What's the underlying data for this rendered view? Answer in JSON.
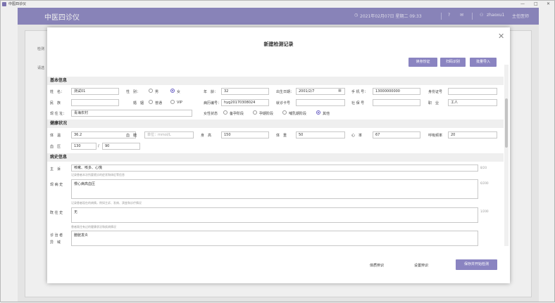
{
  "window": {
    "title": "中医四诊仪",
    "min": "—",
    "max": "□",
    "close": "✕"
  },
  "topbar": {
    "app_title": "中医四诊仪",
    "datetime": "2021年02月07日 星期二 09:33",
    "user": "zhaoxu1",
    "role": "主任医师"
  },
  "background": {
    "label_1": "检测",
    "label_2": "请选"
  },
  "modal": {
    "title": "新建检测记录",
    "buttons": {
      "read_id": "读身份证",
      "scan_code": "扫码识别",
      "quick_import": "批量导入"
    },
    "basic": {
      "heading": "基本信息",
      "name_label": "姓　名：",
      "name_value": "测试01",
      "gender_label": "性　别：",
      "gender_male": "男",
      "gender_female": "女",
      "age_label": "年　龄：",
      "age_value": "32",
      "birth_label": "出生日期：",
      "birth_value": "2001/2/7",
      "phone_label": "手 机 号：",
      "phone_value": "13000000000",
      "idcard_label": "身份证号",
      "ethnic_label": "民　族",
      "marital_label": "婚　姻",
      "marital_opt1": "普通",
      "marital_opt2": "VIP",
      "code_label": "病历编号：",
      "code_value": "hyg20170308024",
      "medical_label": "就诊卡号",
      "social_label": "社 保 号",
      "job_label": "职　业",
      "job_value": "工人",
      "addr_label": "现 住 址：",
      "addr_value": "青海农村",
      "female_status_label": "女性状态",
      "female_opt1": "备孕阶段",
      "female_opt2": "孕期阶段",
      "female_opt3": "哺乳期阶段",
      "female_opt4": "其他"
    },
    "vitals": {
      "heading": "健康状况",
      "temp_label": "体　温",
      "temp_value": "36.2",
      "bp_label": "血　糖",
      "bp_placeholder": "单位：mmol/L",
      "height_label": "身　高",
      "height_value": "150",
      "weight_label": "体　重",
      "weight_value": "50",
      "heart_label": "心　率",
      "heart_value": "67",
      "breath_label": "呼吸频率",
      "breath_value": "20",
      "pressure_label": "血　压",
      "pressure_high": "130",
      "pressure_sep": "/",
      "pressure_low": "90"
    },
    "history": {
      "heading": "病史信息",
      "chief_label": "主　诉",
      "chief_value": "咳嗽、咳多、心慌",
      "chief_hint": "记录患者本次所要就诊的症状和体征等信息",
      "chief_count": "8/20",
      "present_label": "现 病 史",
      "present_value": "慢心病高血压",
      "present_hint": "记录患者现在的病情，例如主诉、发病、演变和诊疗情况",
      "present_count": "6/200",
      "past_label": "既 往 史",
      "past_value": "无",
      "past_hint": "患者既往有过的健康状况和疾病情况",
      "past_count": "1/200",
      "other_label": "诊 治 者",
      "other_label2": "异　域",
      "other_value": "膀胱发炎"
    },
    "footer": {
      "tongue": "体质辨识",
      "pulse": "设置辨识",
      "start": "保存并开始检测"
    }
  }
}
